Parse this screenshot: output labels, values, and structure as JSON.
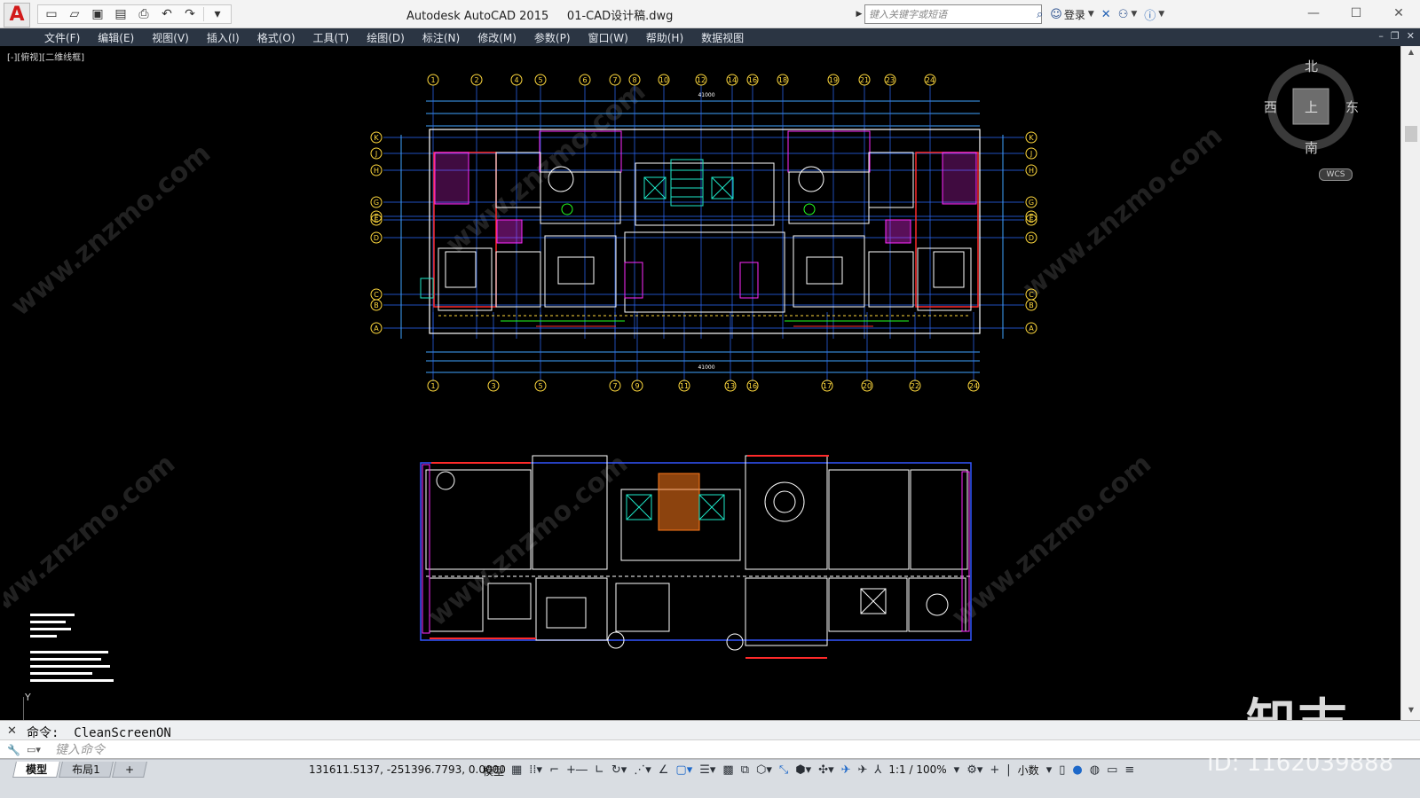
{
  "titlebar": {
    "app_logo": "A",
    "app_name": "Autodesk AutoCAD 2015",
    "file_name": "01-CAD设计稿.dwg",
    "search_placeholder": "键入关键字或短语",
    "login_label": "登录",
    "quick_access_icons": [
      "new-icon",
      "open-icon",
      "save-icon",
      "save-as-icon",
      "print-icon",
      "undo-icon",
      "redo-icon",
      "customize-icon"
    ]
  },
  "menu": {
    "items": [
      "文件(F)",
      "编辑(E)",
      "视图(V)",
      "插入(I)",
      "格式(O)",
      "工具(T)",
      "绘图(D)",
      "标注(N)",
      "修改(M)",
      "参数(P)",
      "窗口(W)",
      "帮助(H)",
      "数据视图"
    ]
  },
  "viewport": {
    "view_label": "[-][俯视][二维线框]",
    "compass": {
      "north": "北",
      "south": "南",
      "east": "东",
      "west": "西",
      "top": "上"
    },
    "wcs_label": "WCS",
    "ucs_y": "Y"
  },
  "plan": {
    "top_axes": [
      "1",
      "2",
      "4",
      "5",
      "6",
      "7",
      "8",
      "10",
      "12",
      "14",
      "16",
      "18",
      "19",
      "21",
      "23",
      "24"
    ],
    "bottom_axes": [
      "1",
      "3",
      "5",
      "7",
      "9",
      "11",
      "13",
      "16",
      "17",
      "20",
      "22",
      "24"
    ],
    "row_axes": [
      "K",
      "J",
      "H",
      "G",
      "F",
      "E",
      "D",
      "C",
      "B",
      "A"
    ],
    "total_dim": "41000"
  },
  "watermark": {
    "site": "www.znzmo.com",
    "brand": "知末",
    "id": "ID: 1162039888"
  },
  "command": {
    "history_text": "命令: _CleanScreenON",
    "input_placeholder": "键入命令"
  },
  "status": {
    "tabs": [
      "模型",
      "布局1",
      "+"
    ],
    "coordinates": "131611.5137, -251396.7793, 0.0000",
    "model_label": "模型",
    "scale": "1:1 / 100%",
    "units": "小数"
  }
}
